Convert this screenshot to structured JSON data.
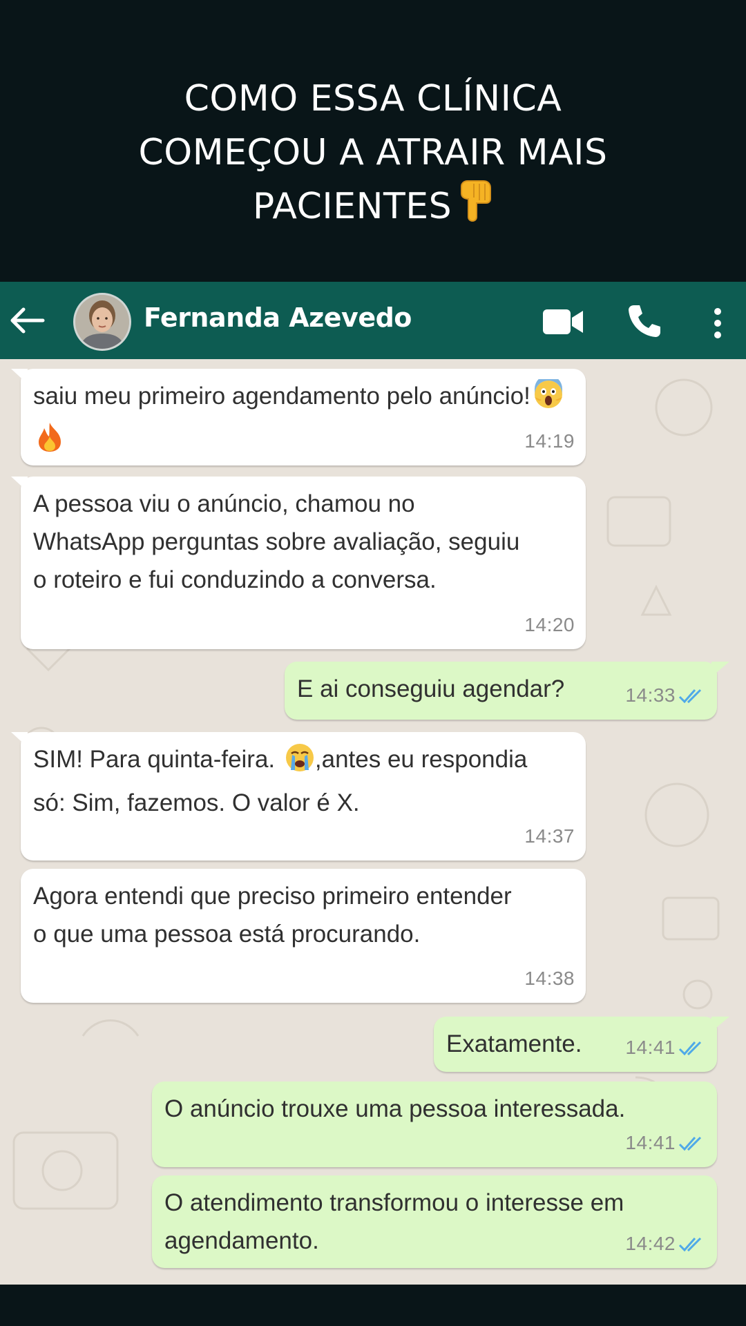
{
  "headline": {
    "lines": [
      "COMO ESSA CLÍNICA",
      "COMEÇOU A ATRAIR MAIS",
      "PACIENTES"
    ],
    "emoji_icon": "backhand-index-pointing-down-icon"
  },
  "appbar": {
    "contact_name": "Fernanda Azevedo",
    "icons": [
      "back-arrow-icon",
      "avatar",
      "video-call-icon",
      "phone-icon",
      "more-options-icon"
    ],
    "color": "#0d5c52"
  },
  "colors": {
    "background": "#091518",
    "incoming_bubble": "#ffffff",
    "outgoing_bubble": "#dcf8c6",
    "read_ticks": "#4fa9e8",
    "timestamp": "#8a8a8a"
  },
  "messages": [
    {
      "direction": "in",
      "text": "saiu meu primeiro agendamento pelo anúncio!",
      "emojis": [
        "screaming-face-icon",
        "fire-icon"
      ],
      "time": "14:19"
    },
    {
      "direction": "in",
      "text": "A pessoa viu o anúncio, chamou no WhatsApp perguntas sobre avaliação, seguiu o roteiro e fui conduzindo a conversa.",
      "time": "14:20"
    },
    {
      "direction": "out",
      "text": "E ai conseguiu agendar?",
      "time": "14:33",
      "status": "read"
    },
    {
      "direction": "in",
      "text_before": "SIM! Para quinta-feira.",
      "emoji": "crying-face-icon",
      "text_after": ",antes eu respondia só: Sim, fazemos. O valor é X.",
      "time": "14:37"
    },
    {
      "direction": "in",
      "text": "Agora entendi que preciso primeiro entender o que uma pessoa está procurando.",
      "time": "14:38"
    },
    {
      "direction": "out",
      "text": "Exatamente.",
      "time": "14:41",
      "status": "read"
    },
    {
      "direction": "out",
      "text": "O anúncio trouxe uma pessoa interessada.",
      "time": "14:41",
      "status": "read"
    },
    {
      "direction": "out",
      "text": "O atendimento transformou o interesse em agendamento.",
      "time": "14:42",
      "status": "read"
    }
  ]
}
